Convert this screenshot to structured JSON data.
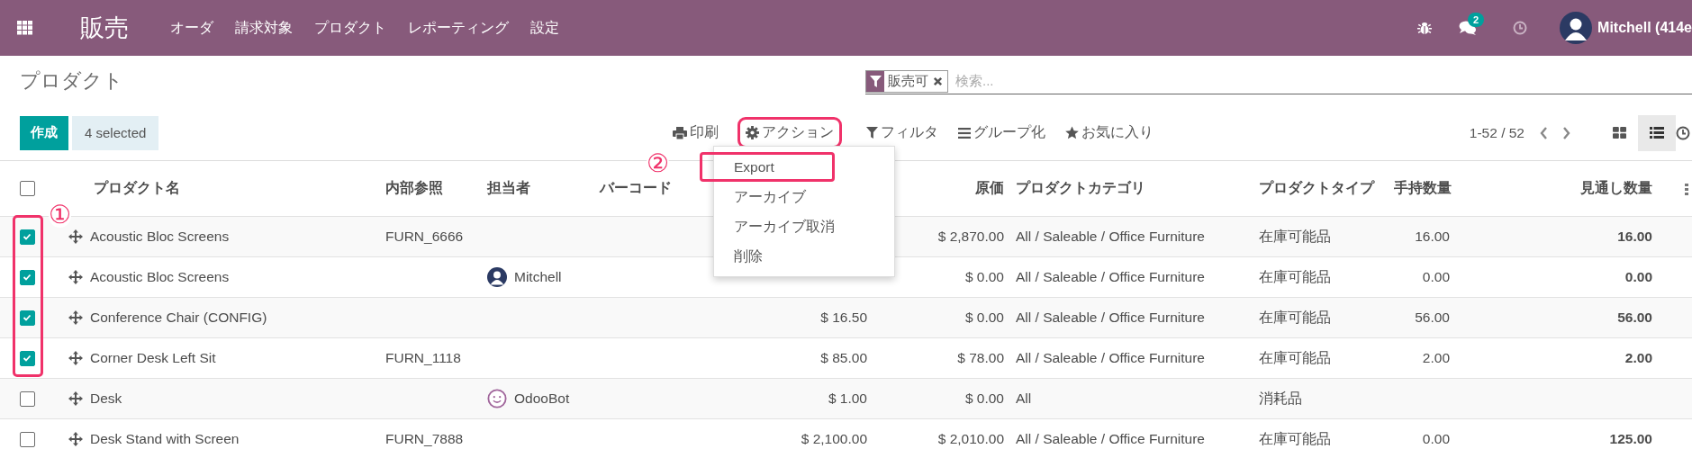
{
  "topbar": {
    "app": "販売",
    "menu": [
      "オーダ",
      "請求対象",
      "プロダクト",
      "レポーティング",
      "設定"
    ],
    "messages_badge": "2",
    "user": "Mitchell (414e"
  },
  "control_panel": {
    "title": "プロダクト",
    "search": {
      "facet": "販売可",
      "placeholder": "検索..."
    },
    "create": "作成",
    "selection": "4 selected",
    "print": "印刷",
    "action": {
      "label": "アクション",
      "highlighted": true,
      "callout": "②"
    },
    "action_menu": [
      {
        "label": "Export",
        "highlighted": true
      },
      {
        "label": "アーカイブ",
        "highlighted": false
      },
      {
        "label": "アーカイブ取消",
        "highlighted": false
      },
      {
        "label": "削除",
        "highlighted": false
      }
    ],
    "filters": "フィルタ",
    "group_by": "グループ化",
    "favorites": "お気に入り",
    "pager": "1-52 / 52",
    "views": [
      {
        "kind": "kanban",
        "selected": false
      },
      {
        "kind": "list",
        "selected": true
      },
      {
        "kind": "activity",
        "selected": false
      }
    ]
  },
  "table": {
    "columns": {
      "name": "プロダクト名",
      "reference": "内部参照",
      "responsible": "担当者",
      "barcode": "バーコード",
      "cost": "原価",
      "category": "プロダクトカテゴリ",
      "type": "プロダクトタイプ",
      "on_hand": "手持数量",
      "forecast": "見通し数量"
    },
    "select_all": {
      "checked": false
    },
    "selection_callout": "①",
    "rows": [
      {
        "selected": true,
        "name": "Acoustic Bloc Screens",
        "reference": "FURN_6666",
        "cost": "$ 2,870.00",
        "category": "All / Saleable / Office Furniture",
        "type": "在庫可能品",
        "on_hand": "16.00",
        "forecast": "16.00"
      },
      {
        "selected": true,
        "name": "Acoustic Bloc Screens",
        "responsible": {
          "name": "Mitchell",
          "kind": "person"
        },
        "cost": "$ 0.00",
        "category": "All / Saleable / Office Furniture",
        "type": "在庫可能品",
        "on_hand": "0.00",
        "forecast": "0.00"
      },
      {
        "selected": true,
        "name": "Conference Chair (CONFIG)",
        "sales_price": "$ 16.50",
        "cost": "$ 0.00",
        "category": "All / Saleable / Office Furniture",
        "type": "在庫可能品",
        "on_hand": "56.00",
        "forecast": "56.00"
      },
      {
        "selected": true,
        "name": "Corner Desk Left Sit",
        "reference": "FURN_1118",
        "sales_price": "$ 85.00",
        "cost": "$ 78.00",
        "category": "All / Saleable / Office Furniture",
        "type": "在庫可能品",
        "on_hand": "2.00",
        "forecast": "2.00"
      },
      {
        "selected": false,
        "name": "Desk",
        "responsible": {
          "name": "OdooBot",
          "kind": "bot"
        },
        "sales_price": "$ 1.00",
        "cost": "$ 0.00",
        "category": "All",
        "type": "消耗品"
      },
      {
        "selected": false,
        "name": "Desk Stand with Screen",
        "reference": "FURN_7888",
        "sales_price": "$ 2,100.00",
        "cost": "$ 2,010.00",
        "category": "All / Saleable / Office Furniture",
        "type": "在庫可能品",
        "on_hand": "0.00",
        "forecast": "125.00"
      }
    ]
  }
}
